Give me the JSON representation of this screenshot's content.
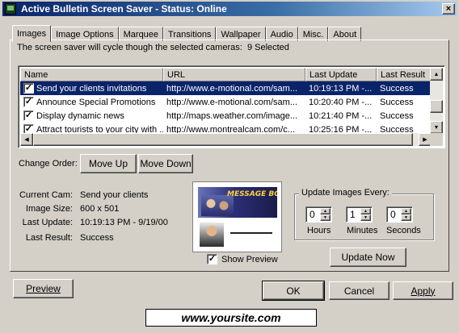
{
  "window": {
    "title": "Active Bulletin Screen Saver - Status: Online",
    "close_glyph": "×"
  },
  "tabs": [
    {
      "label": "Images"
    },
    {
      "label": "Image Options"
    },
    {
      "label": "Marquee"
    },
    {
      "label": "Transitions"
    },
    {
      "label": "Wallpaper"
    },
    {
      "label": "Audio"
    },
    {
      "label": "Misc."
    },
    {
      "label": "About"
    }
  ],
  "images_tab": {
    "intro_text": "The screen saver will cycle though the selected cameras:",
    "selected_count": "9 Selected",
    "columns": [
      "Name",
      "URL",
      "Last Update",
      "Last Result"
    ],
    "rows": [
      {
        "checked": true,
        "name": "Send your clients invitations",
        "url": "http://www.e-motional.com/sam...",
        "last_update": "10:19:13 PM -...",
        "last_result": "Success",
        "selected": true
      },
      {
        "checked": true,
        "name": "Announce Special Promotions",
        "url": "http://www.e-motional.com/sam...",
        "last_update": "10:20:40 PM -...",
        "last_result": "Success",
        "selected": false
      },
      {
        "checked": true,
        "name": "Display dynamic news",
        "url": "http://maps.weather.com/image...",
        "last_update": "10:21:40 PM -...",
        "last_result": "Success",
        "selected": false
      },
      {
        "checked": true,
        "name": "Attract tourists to your city with ...",
        "url": "http://www.montrealcam.com/c...",
        "last_update": "10:25:16 PM -...",
        "last_result": "Success",
        "selected": false
      }
    ],
    "change_order_label": "Change Order:",
    "move_up_label": "Move Up",
    "move_down_label": "Move Down",
    "details": {
      "current_cam_label": "Current Cam:",
      "current_cam_value": "Send your clients",
      "image_size_label": "Image Size:",
      "image_size_value": "600 x 501",
      "last_update_label": "Last Update:",
      "last_update_value": "10:19:13 PM - 9/19/00",
      "last_result_label": "Last Result:",
      "last_result_value": "Success"
    },
    "preview_thumbnail": {
      "headline": "MESSAGE BOARDS CHAT"
    },
    "show_preview_label": "Show Preview",
    "show_preview_checked": true,
    "update_group": {
      "title": "Update Images Every:",
      "hours_value": "0",
      "minutes_value": "1",
      "seconds_value": "0",
      "hours_label": "Hours",
      "minutes_label": "Minutes",
      "seconds_label": "Seconds",
      "update_now_label": "Update Now"
    }
  },
  "footer": {
    "preview_label": "Preview",
    "ok_label": "OK",
    "cancel_label": "Cancel",
    "apply_label": "Apply",
    "site_label": "www.yoursite.com"
  },
  "colors": {
    "title_bar": "#0a246a",
    "selection": "#0a246a",
    "face": "#d4d0c8"
  }
}
